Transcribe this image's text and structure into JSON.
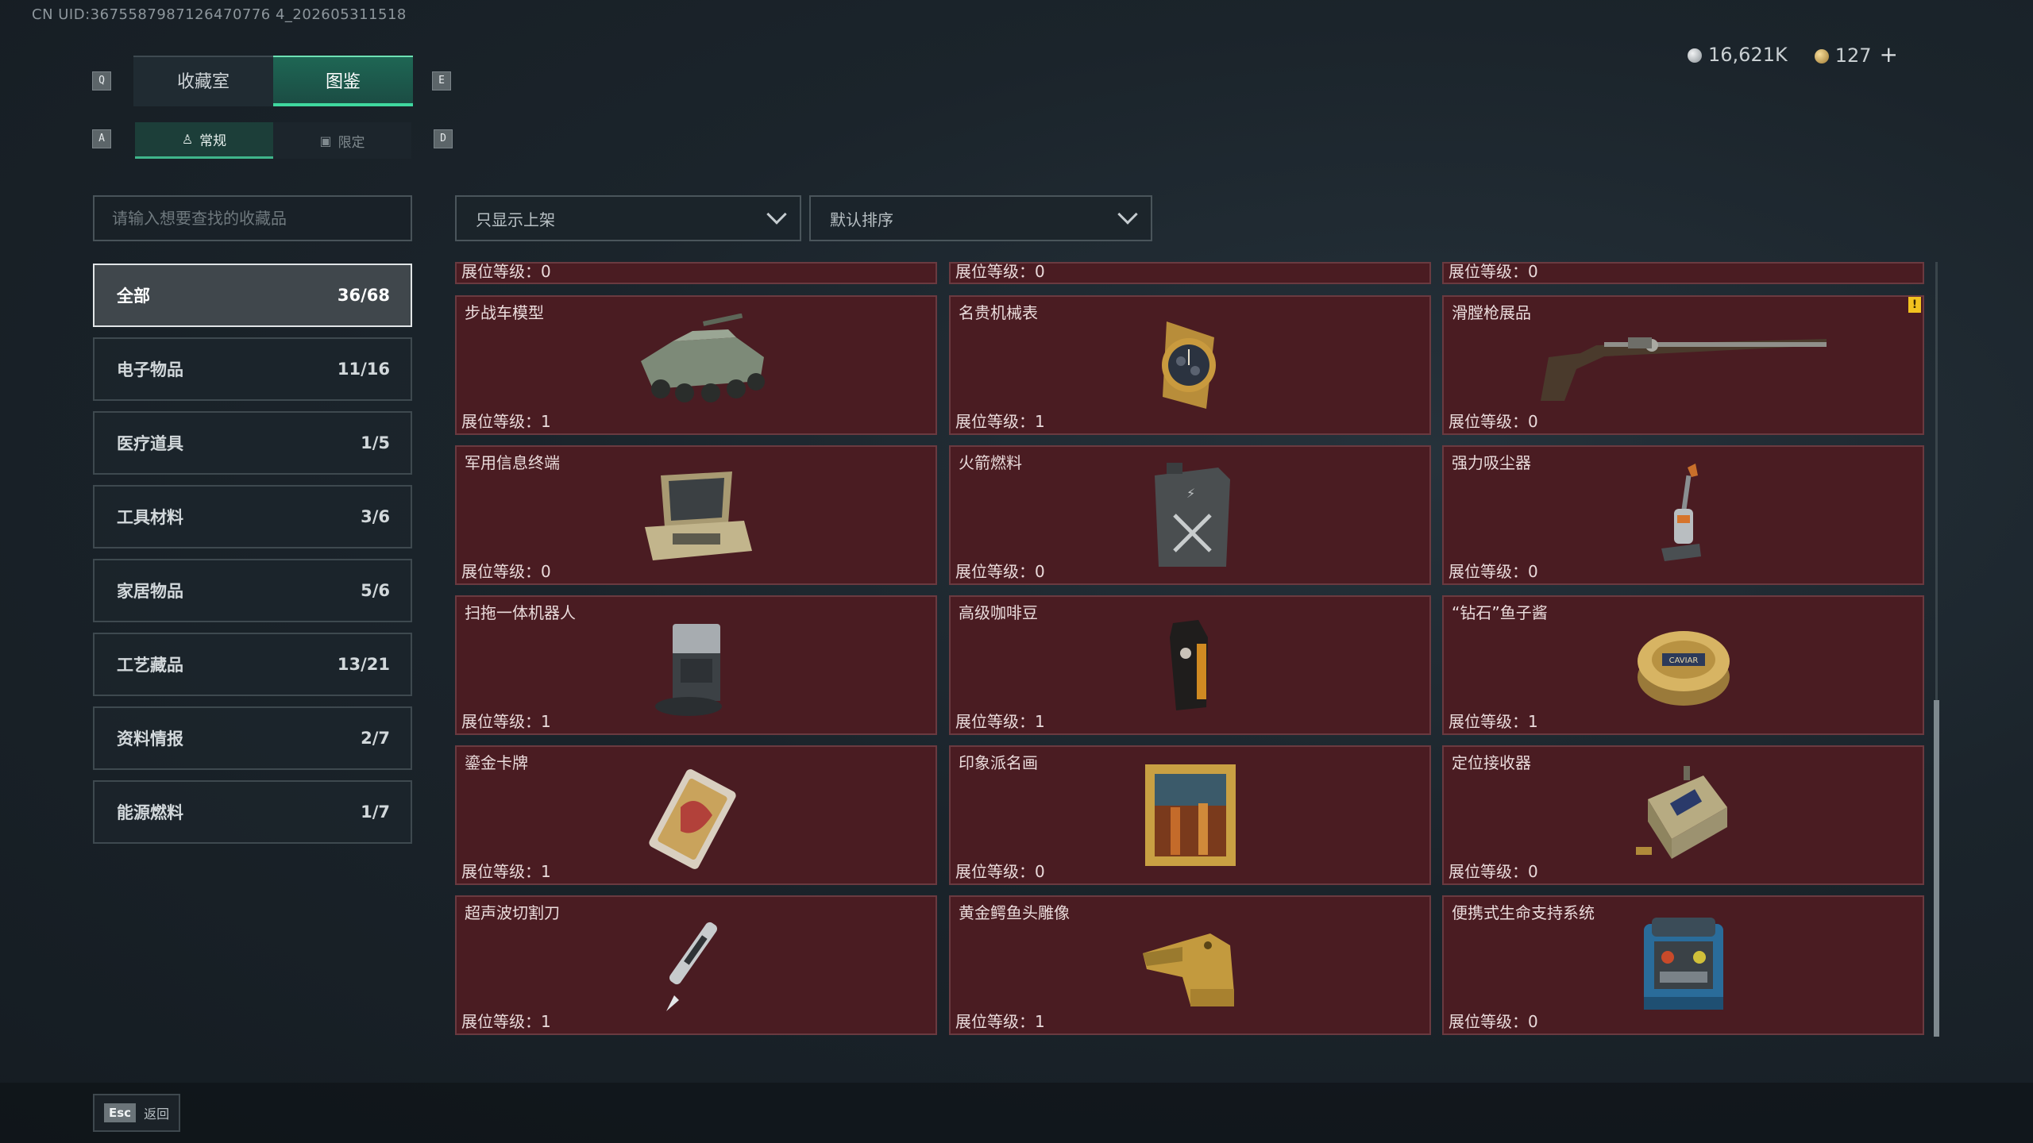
{
  "uid_text": "CN UID:3675587987126470776 4_202605311518",
  "keys": {
    "q": "Q",
    "e": "E",
    "a": "A",
    "d": "D"
  },
  "main_tabs": [
    {
      "label": "收藏室"
    },
    {
      "label": "图鉴"
    }
  ],
  "sub_tabs": [
    {
      "label": "常规",
      "icon": "figure-icon"
    },
    {
      "label": "限定",
      "icon": "image-icon"
    }
  ],
  "currency": {
    "silver": "16,621K",
    "gold": "127",
    "plus": "+"
  },
  "search": {
    "placeholder": "请输入想要查找的收藏品"
  },
  "filters": {
    "display": "只显示上架",
    "sort": "默认排序"
  },
  "categories": [
    {
      "label": "全部",
      "count": "36/68"
    },
    {
      "label": "电子物品",
      "count": "11/16"
    },
    {
      "label": "医疗道具",
      "count": "1/5"
    },
    {
      "label": "工具材料",
      "count": "3/6"
    },
    {
      "label": "家居物品",
      "count": "5/6"
    },
    {
      "label": "工艺藏品",
      "count": "13/21"
    },
    {
      "label": "资料情报",
      "count": "2/7"
    },
    {
      "label": "能源燃料",
      "count": "1/7"
    }
  ],
  "partial_row": [
    {
      "level": "展位等级：0"
    },
    {
      "level": "展位等级：0"
    },
    {
      "level": "展位等级：0"
    }
  ],
  "items": [
    {
      "name": "步战车模型",
      "level": "展位等级：1",
      "icon": "ifv-model-icon"
    },
    {
      "name": "名贵机械表",
      "level": "展位等级：1",
      "icon": "watch-icon"
    },
    {
      "name": "滑膛枪展品",
      "level": "展位等级：0",
      "icon": "musket-icon",
      "alert": "!"
    },
    {
      "name": "军用信息终端",
      "level": "展位等级：0",
      "icon": "terminal-icon"
    },
    {
      "name": "火箭燃料",
      "level": "展位等级：0",
      "icon": "fuel-can-icon"
    },
    {
      "name": "强力吸尘器",
      "level": "展位等级：0",
      "icon": "vacuum-icon"
    },
    {
      "name": "扫拖一体机器人",
      "level": "展位等级：1",
      "icon": "robot-vacuum-icon"
    },
    {
      "name": "高级咖啡豆",
      "level": "展位等级：1",
      "icon": "coffee-bag-icon"
    },
    {
      "name": "“钻石”鱼子酱",
      "level": "展位等级：1",
      "icon": "caviar-icon",
      "caviar_label": "CAVIAR"
    },
    {
      "name": "鎏金卡牌",
      "level": "展位等级：1",
      "icon": "card-icon"
    },
    {
      "name": "印象派名画",
      "level": "展位等级：0",
      "icon": "painting-icon"
    },
    {
      "name": "定位接收器",
      "level": "展位等级：0",
      "icon": "receiver-icon"
    },
    {
      "name": "超声波切割刀",
      "level": "展位等级：1",
      "icon": "cutter-icon"
    },
    {
      "name": "黄金鳄鱼头雕像",
      "level": "展位等级：1",
      "icon": "croc-statue-icon"
    },
    {
      "name": "便携式生命支持系统",
      "level": "展位等级：0",
      "icon": "life-support-icon"
    }
  ],
  "footer": {
    "esc_key": "Esc",
    "esc_label": "返回"
  }
}
